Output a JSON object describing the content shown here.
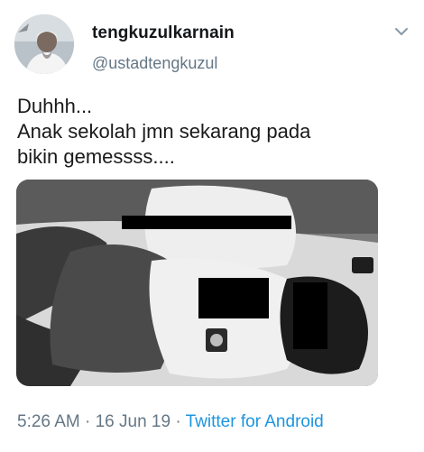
{
  "tweet": {
    "display_name": "tengkuzulkarnain",
    "handle": "@ustadtengkuzul",
    "text_lines": [
      "Duhhh...",
      "Anak sekolah jmn sekarang pada",
      "bikin gemessss...."
    ],
    "time": "5:26 AM",
    "separator": " · ",
    "date": "16 Jun 19",
    "source": "Twitter for Android"
  },
  "icons": {
    "menu": "chevron-down-icon"
  },
  "colors": {
    "handle": "#657786",
    "link": "#1b95e0",
    "text": "#1a1a1a"
  }
}
